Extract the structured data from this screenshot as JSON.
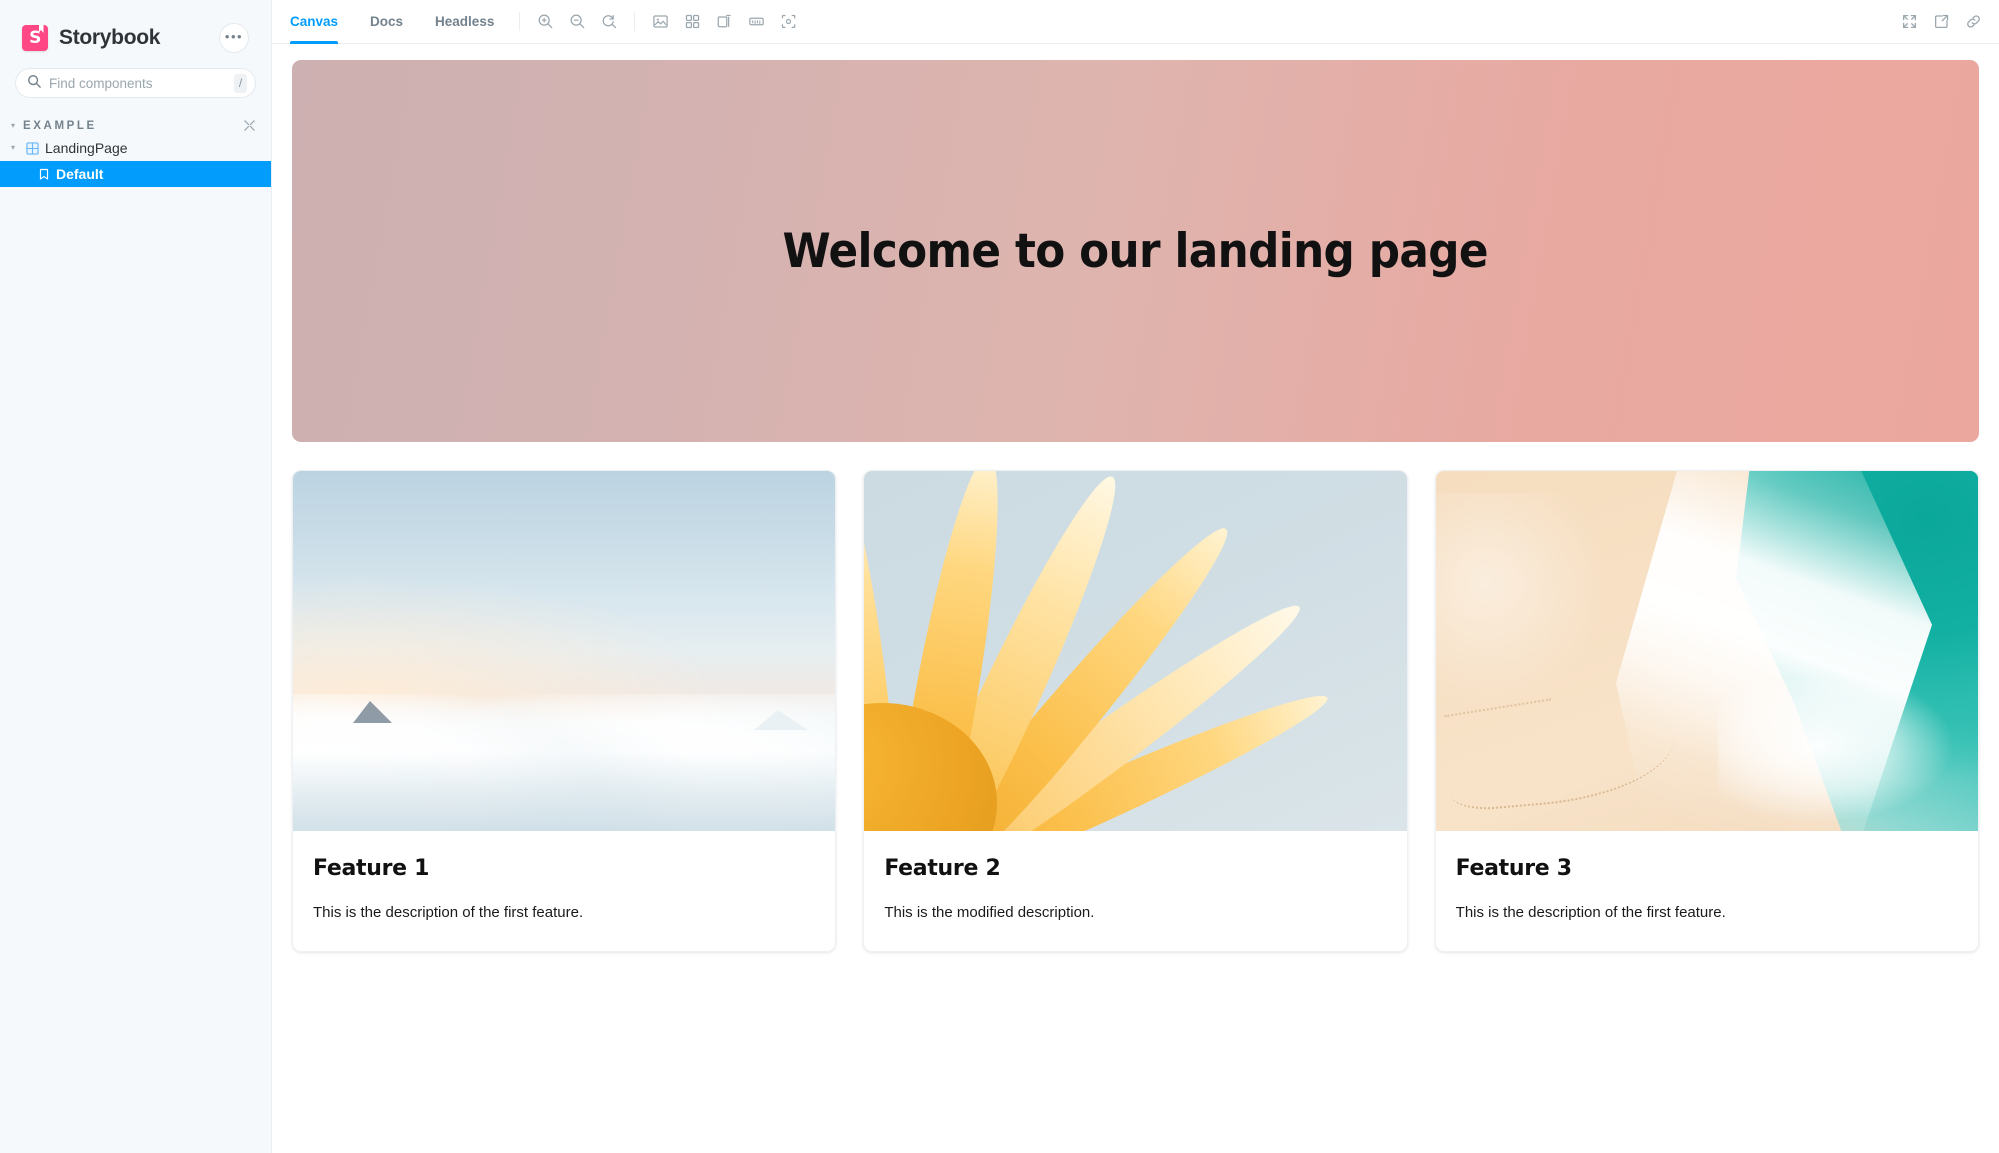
{
  "sidebar": {
    "brand": {
      "name": "Storybook",
      "logo_letter": "S",
      "logo_color": "#FF4785"
    },
    "menu_button_label": "•••",
    "search": {
      "placeholder": "Find components",
      "value": "",
      "shortcut": "/"
    },
    "group": {
      "label": "EXAMPLE",
      "caret": "▾",
      "collapse_tooltip": "Collapse all"
    },
    "items": [
      {
        "label": "LandingPage",
        "level": 2,
        "icon": "component-grid-icon",
        "caret": "▾",
        "selected": false
      },
      {
        "label": "Default",
        "level": 3,
        "icon": "bookmark-icon",
        "selected": true
      }
    ]
  },
  "toolbar": {
    "tabs": [
      {
        "label": "Canvas",
        "active": true
      },
      {
        "label": "Docs",
        "active": false
      },
      {
        "label": "Headless",
        "active": false
      }
    ],
    "zoom_tools": [
      {
        "name": "zoom-in-icon",
        "title": "Zoom in"
      },
      {
        "name": "zoom-out-icon",
        "title": "Zoom out"
      },
      {
        "name": "zoom-reset-icon",
        "title": "Reset zoom"
      }
    ],
    "addon_tools": [
      {
        "name": "backgrounds-icon",
        "title": "Change background"
      },
      {
        "name": "grid-icon",
        "title": "Apply a grid to the preview"
      },
      {
        "name": "viewport-icon",
        "title": "Change the size of the preview"
      },
      {
        "name": "measure-icon",
        "title": "Enable measure"
      },
      {
        "name": "outline-icon",
        "title": "Apply outlines to the preview"
      }
    ],
    "right_tools": [
      {
        "name": "fullscreen-icon",
        "title": "Go full screen"
      },
      {
        "name": "open-new-tab-icon",
        "title": "Open canvas in new tab"
      },
      {
        "name": "copy-link-icon",
        "title": "Copy canvas link"
      }
    ]
  },
  "story": {
    "hero": {
      "title": "Welcome to our landing page",
      "gradient_from": "#cdb0b1",
      "gradient_to": "#eba79e"
    },
    "cards": [
      {
        "image": "clouds-over-mountains-image",
        "title": "Feature 1",
        "description": "This is the description of the first feature."
      },
      {
        "image": "yellow-petals-image",
        "title": "Feature 2",
        "description": "This is the modified description."
      },
      {
        "image": "aerial-beach-image",
        "title": "Feature 3",
        "description": "This is the description of the first feature."
      }
    ]
  }
}
